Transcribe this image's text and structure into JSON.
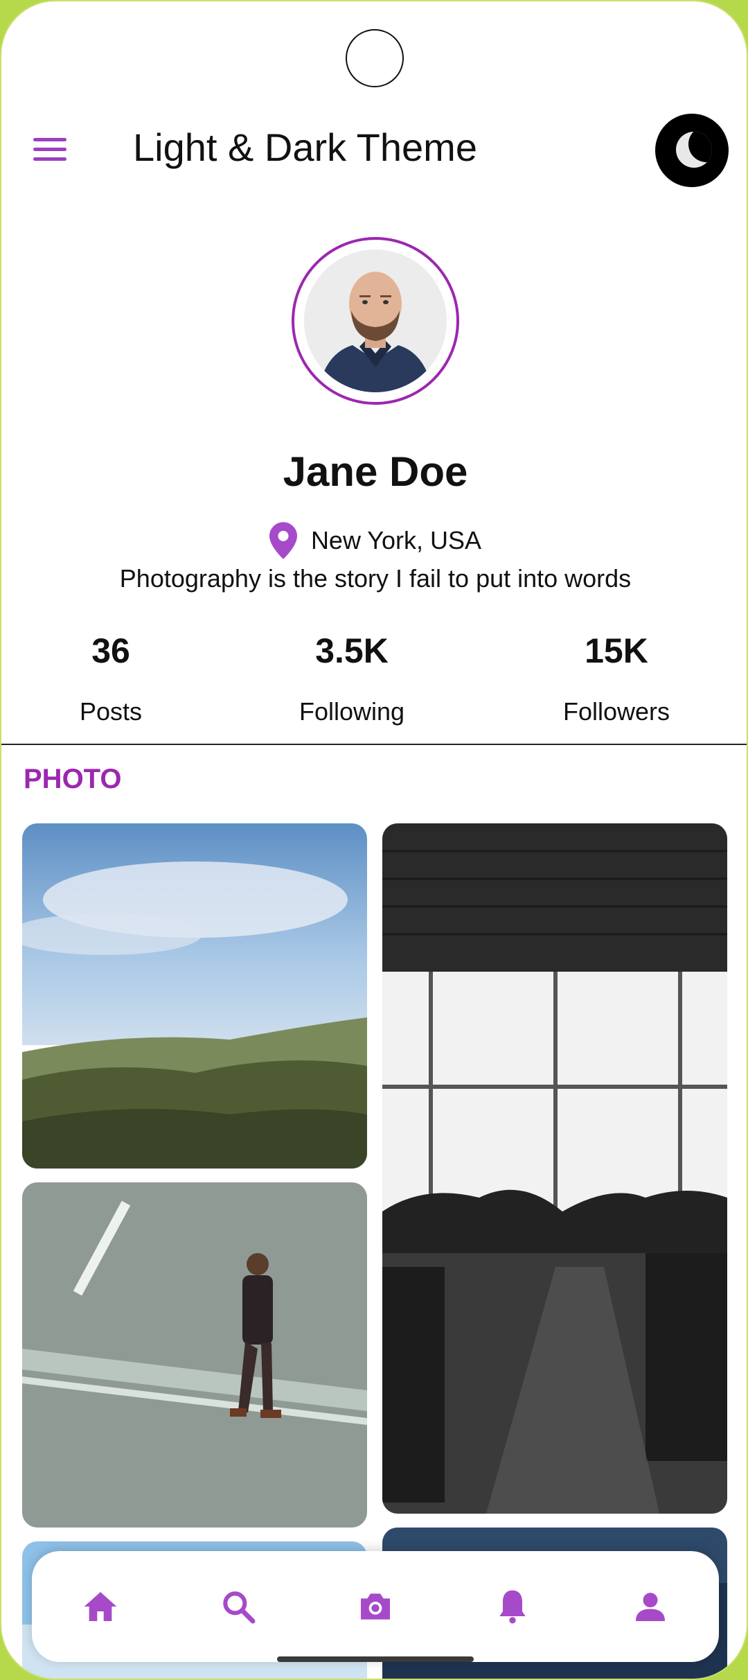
{
  "app": {
    "title": "Light & Dark Theme",
    "accent_color": "#9c27b0",
    "menu_icon": "menu-icon",
    "theme_toggle_icon": "moon-icon"
  },
  "profile": {
    "name": "Jane Doe",
    "location": "New York, USA",
    "bio": "Photography is the story I fail to put into words",
    "avatar_alt": "profile-photo"
  },
  "stats": [
    {
      "value": "36",
      "label": "Posts"
    },
    {
      "value": "3.5K",
      "label": "Following"
    },
    {
      "value": "15K",
      "label": "Followers"
    }
  ],
  "gallery": {
    "section_title": "PHOTO",
    "photos": [
      {
        "name": "landscape-photo"
      },
      {
        "name": "cafe-interior-photo"
      },
      {
        "name": "man-walking-photo"
      },
      {
        "name": "sky-photo"
      },
      {
        "name": "ocean-photo"
      }
    ]
  },
  "bottom_nav": {
    "items": [
      {
        "icon": "home-icon"
      },
      {
        "icon": "search-icon"
      },
      {
        "icon": "camera-icon"
      },
      {
        "icon": "bell-icon"
      },
      {
        "icon": "person-icon"
      }
    ]
  }
}
